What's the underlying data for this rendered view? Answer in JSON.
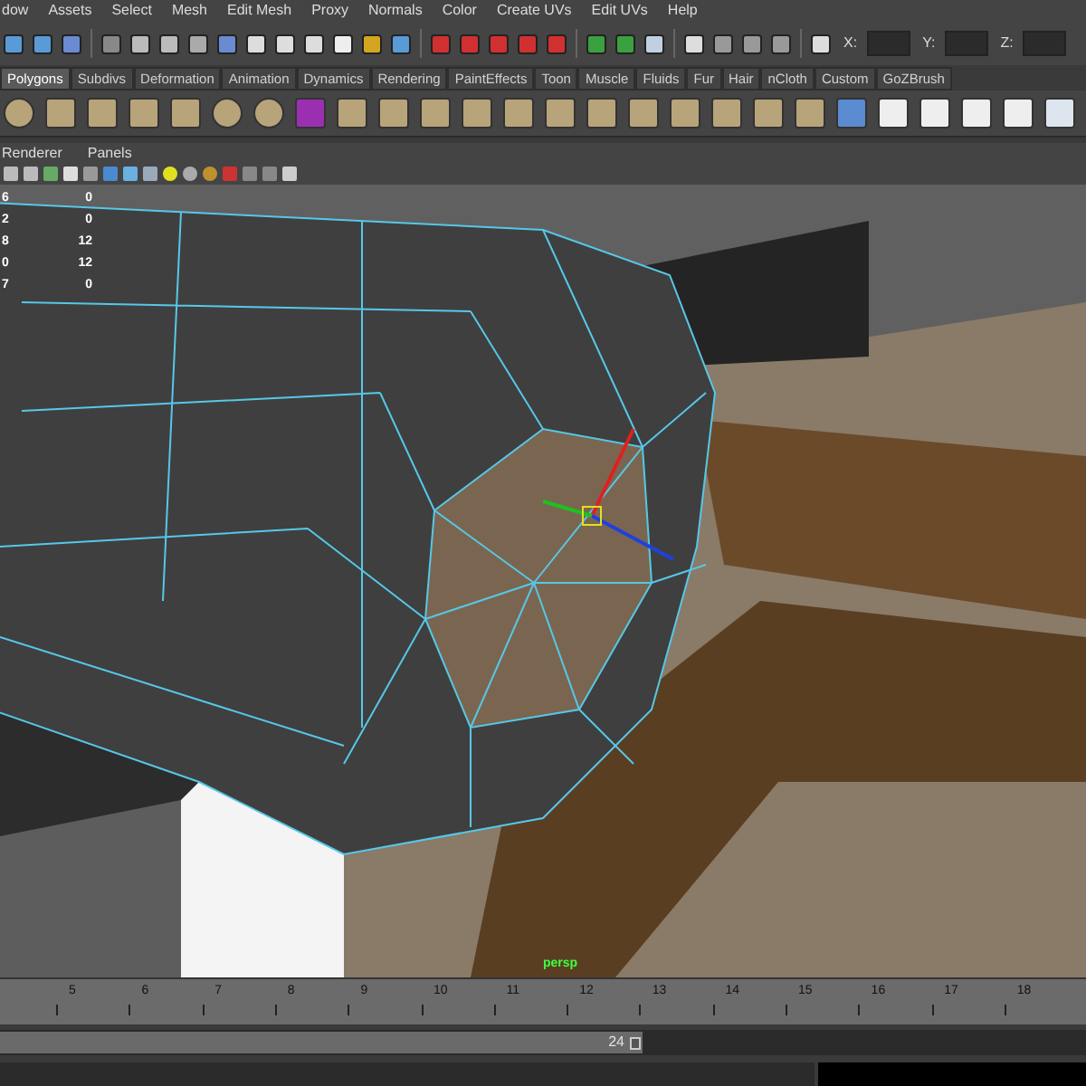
{
  "menu_bar": [
    "dow",
    "Assets",
    "Select",
    "Mesh",
    "Edit Mesh",
    "Proxy",
    "Normals",
    "Color",
    "Create UVs",
    "Edit UVs",
    "Help"
  ],
  "toolbar": {
    "fields": [
      {
        "label": "X:"
      },
      {
        "label": "Y:"
      },
      {
        "label": "Z:"
      }
    ]
  },
  "shelf_tabs": [
    {
      "label": "Polygons",
      "selected": true
    },
    {
      "label": "Subdivs",
      "selected": false
    },
    {
      "label": "Deformation",
      "selected": false
    },
    {
      "label": "Animation",
      "selected": false
    },
    {
      "label": "Dynamics",
      "selected": false
    },
    {
      "label": "Rendering",
      "selected": false
    },
    {
      "label": "PaintEffects",
      "selected": false
    },
    {
      "label": "Toon",
      "selected": false
    },
    {
      "label": "Muscle",
      "selected": false
    },
    {
      "label": "Fluids",
      "selected": false
    },
    {
      "label": "Fur",
      "selected": false
    },
    {
      "label": "Hair",
      "selected": false
    },
    {
      "label": "nCloth",
      "selected": false
    },
    {
      "label": "Custom",
      "selected": false
    },
    {
      "label": "GoZBrush",
      "selected": false
    }
  ],
  "panel_menu": [
    "Renderer",
    "Panels"
  ],
  "viewport": {
    "camera": "persp",
    "stats": [
      {
        "column_1": "6",
        "column_2": "0"
      },
      {
        "column_1": "2",
        "column_2": "0"
      },
      {
        "column_1": "8",
        "column_2": "12"
      },
      {
        "column_1": "0",
        "column_2": "12"
      },
      {
        "column_1": "7",
        "column_2": "0"
      }
    ]
  },
  "time_slider": {
    "ticks": [
      "5",
      "6",
      "7",
      "8",
      "9",
      "10",
      "11",
      "12",
      "13",
      "14",
      "15",
      "16",
      "17",
      "18"
    ]
  },
  "range_slider": {
    "end": "24"
  }
}
